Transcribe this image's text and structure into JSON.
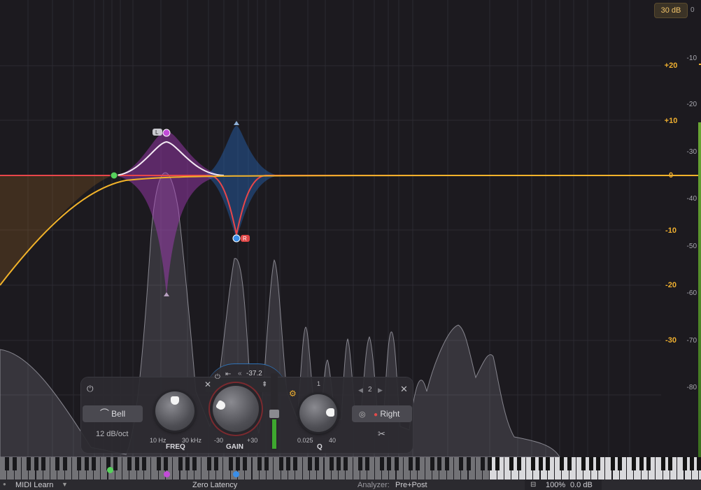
{
  "range": {
    "badge": "30 dB",
    "zero": "0"
  },
  "gain_scale": [
    "+20",
    "+10",
    "0",
    "-10",
    "-20",
    "-30"
  ],
  "db_scale": [
    "-10",
    "-20",
    "-30",
    "-40",
    "-50",
    "-60",
    "-70",
    "-80"
  ],
  "band_panel": {
    "shape_label": "Bell",
    "slope_label": "12 dB/oct",
    "freq": {
      "label": "FREQ",
      "min": "10 Hz",
      "max": "30 kHz"
    },
    "gain": {
      "label": "GAIN",
      "min": "-30",
      "max": "+30",
      "value": "-37.2"
    },
    "q": {
      "label": "Q",
      "min": "0.025",
      "max": "40",
      "top": "1"
    },
    "band_number": "2",
    "stereo_label": "Right"
  },
  "node_tags": {
    "left": "L",
    "right": "R"
  },
  "bottom": {
    "midi_learn": "MIDI Learn",
    "latency": "Zero Latency",
    "analyzer_label": "Analyzer:",
    "analyzer_value": "Pre+Post",
    "zoom": "100%",
    "output_gain": "0.0 dB"
  },
  "colors": {
    "accent": "#f0b030",
    "left_band": "#c24bd8",
    "right_band": "#3a8ee8",
    "low_cut": "#f2b32a",
    "red_curve": "#e8464a"
  }
}
